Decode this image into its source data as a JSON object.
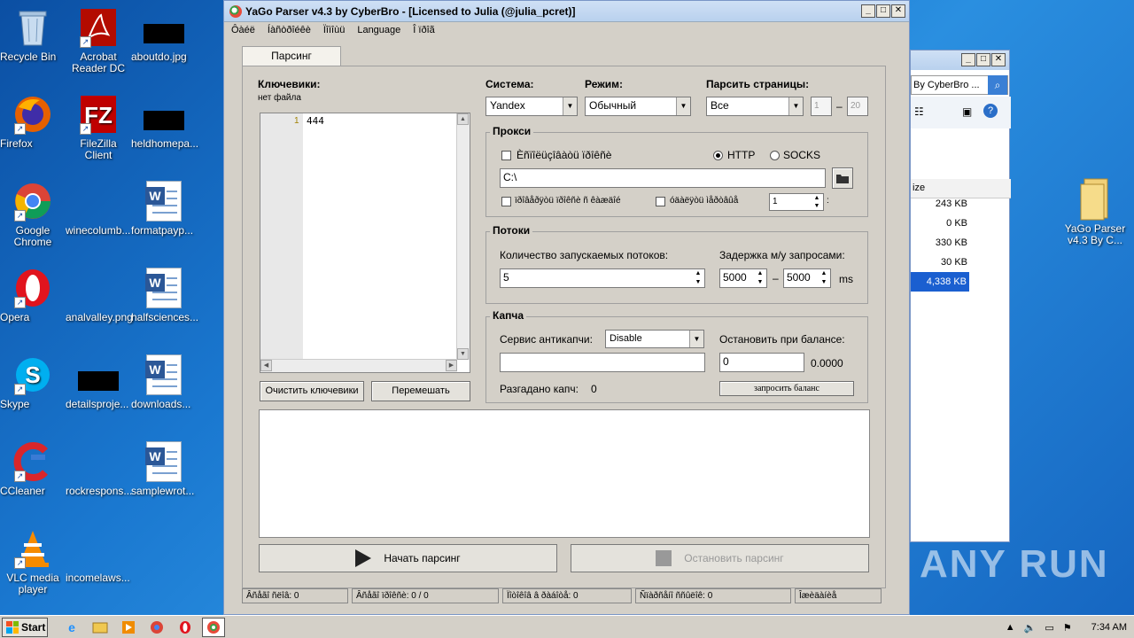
{
  "desktop": {
    "icons": [
      {
        "label": "Recycle Bin"
      },
      {
        "label": "Acrobat Reader DC"
      },
      {
        "label": "aboutdo.jpg"
      },
      {
        "label": "Firefox"
      },
      {
        "label": "FileZilla Client"
      },
      {
        "label": "heldhomepa..."
      },
      {
        "label": "Google Chrome"
      },
      {
        "label": "winecolumb..."
      },
      {
        "label": "formatpayp..."
      },
      {
        "label": "Opera"
      },
      {
        "label": "analvalley.png"
      },
      {
        "label": "halfsciences..."
      },
      {
        "label": "Skype"
      },
      {
        "label": "detailsproje..."
      },
      {
        "label": "downloads..."
      },
      {
        "label": "CCleaner"
      },
      {
        "label": "rockrespons..."
      },
      {
        "label": "samplewrot..."
      },
      {
        "label": "VLC media player"
      },
      {
        "label": "incomelaws..."
      },
      {
        "label": "YaGo Parser v4.3 By C..."
      }
    ],
    "watermark": "ANY RUN"
  },
  "window": {
    "title": "YaGo Parser v4.3 by CyberBro - [Licensed to Julia (@julia_pcret)]",
    "menu": [
      "Ôàéë",
      "Íàñòðîéêè",
      "Ïîìîùü",
      "Language",
      "Î ïðîã"
    ],
    "tab": "Парсинг",
    "keywords": {
      "label": "Ключевики:",
      "file": "нет файла",
      "line_no": "1",
      "content": "444",
      "clear_btn": "Очистить ключевики",
      "shuffle_btn": "Перемешать"
    },
    "system": {
      "label": "Система:",
      "value": "Yandex"
    },
    "mode": {
      "label": "Режим:",
      "value": "Обычный"
    },
    "pages": {
      "label": "Парсить страницы:",
      "value": "Все",
      "from": "1",
      "dash": "–",
      "to": "20"
    },
    "proxy": {
      "title": "Прокси",
      "use_label": "Èñïîëüçîâàòü ïðîêñè",
      "http": "HTTP",
      "socks": "SOCKS",
      "path": "C:\\",
      "check2": "ïðîâåðÿòü ïðîêñè ñ êàæäîé",
      "check3": "óäàëÿòü ìåðòâûå",
      "count": "1",
      "suffix": ":"
    },
    "threads": {
      "title": "Потоки",
      "count_label": "Количество запускаемых потоков:",
      "count": "5",
      "delay_label": "Задержка м/у запросами:",
      "delay_from": "5000",
      "dash": "–",
      "delay_to": "5000",
      "unit": "ms"
    },
    "captcha": {
      "title": "Капча",
      "service_label": "Сервис антикапчи:",
      "service": "Disable",
      "stop_label": "Остановить при балансе:",
      "stop_value": "0",
      "balance": "0.0000",
      "solved_label": "Разгадано капч:",
      "solved": "0",
      "balance_btn": "запросить баланс",
      "key": ""
    },
    "start_btn": "Начать парсинг",
    "stop_btn": "Остановить парсинг",
    "status": [
      "Âñåãî ñëîâ: 0",
      "Âñåãî ïðîêñè: 0 / 0",
      "Ïîòîêîâ â ðàáîòå: 0",
      "Ñïàðñåíî ññûëîê: 0",
      "Îæèäàíèå"
    ]
  },
  "bg_window": {
    "address": "By CyberBro ...",
    "column": "ize",
    "sizes": [
      "243 KB",
      "0 KB",
      "330 KB",
      "30 KB"
    ],
    "selected_size": "4,338 KB"
  },
  "taskbar": {
    "start": "Start",
    "time": "7:34 AM"
  }
}
